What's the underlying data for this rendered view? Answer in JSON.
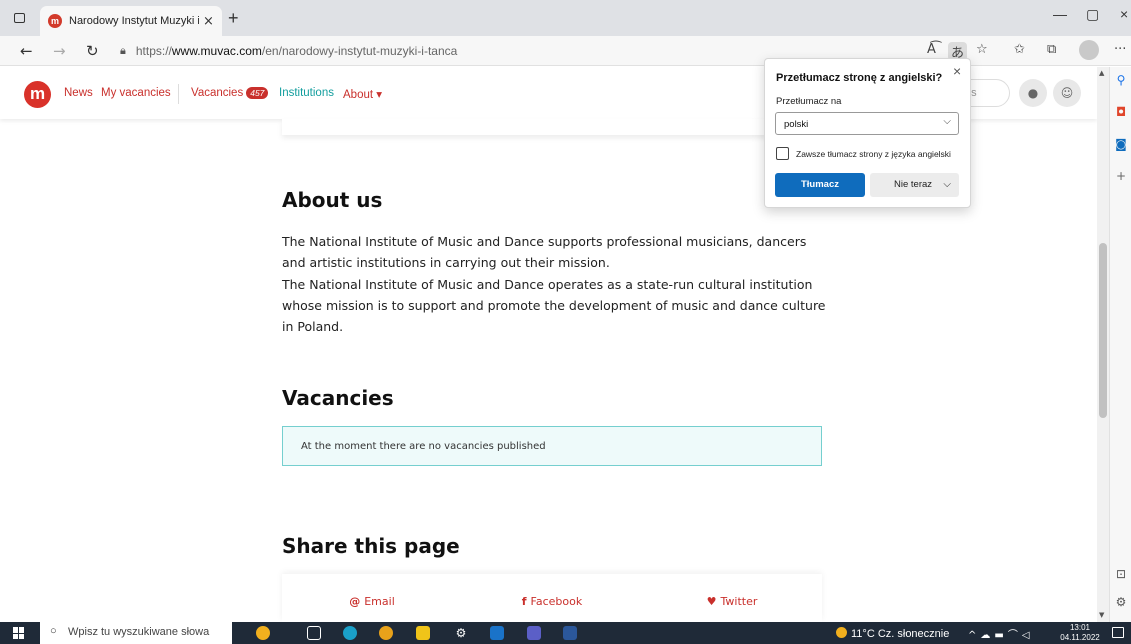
{
  "browser": {
    "tab_title": "Narodowy Instytut Muzyki i Tańca",
    "tab_close": "×",
    "new_tab": "+",
    "window_minimize": "—",
    "window_restore": "▢",
    "window_close": "×",
    "url_prefix": "https://",
    "url_host": "www.muvac.com",
    "url_path": "/en/narodowy-instytut-muzyki-i-tanca",
    "toolbar_more": "···"
  },
  "site": {
    "logo_letter": "m",
    "nav": {
      "news": "News",
      "my_vacancies": "My vacancies",
      "vacancies": "Vacancies",
      "vacancies_count": "457",
      "institutions": "Institutions",
      "about": "About ▾"
    },
    "search_placeholder_visible": "es"
  },
  "about": {
    "heading": "About us",
    "paragraph1": "The National Institute of Music and Dance supports professional musicians, dancers and artistic institutions in carrying out their mission.",
    "paragraph2": "The National Institute of Music and Dance operates as a state-run cultural institution whose mission is to support and promote the development of music and dance culture in Poland."
  },
  "vacancies": {
    "heading": "Vacancies",
    "notice": "At the moment there are no vacancies published"
  },
  "share": {
    "heading": "Share this page",
    "email": "Email",
    "facebook": "Facebook",
    "twitter": "Twitter"
  },
  "translate_popup": {
    "title": "Przetłumacz stronę z angielski?",
    "translate_to_label": "Przetłumacz na",
    "selected_language": "polski",
    "always_translate_label": "Zawsze tłumacz strony z języka angielski",
    "translate_button": "Tłumacz",
    "not_now_button": "Nie teraz"
  },
  "taskbar": {
    "search_placeholder": "Wpisz tu wyszukiwane słowa",
    "weather": "11°C  Cz. słonecznie",
    "time": "13:01",
    "date": "04.11.2022"
  },
  "colors": {
    "brand_red": "#d9322a",
    "link_teal": "#139e9e",
    "edge_blue": "#0f6cbd",
    "taskbar_bg": "#1f2a38"
  }
}
